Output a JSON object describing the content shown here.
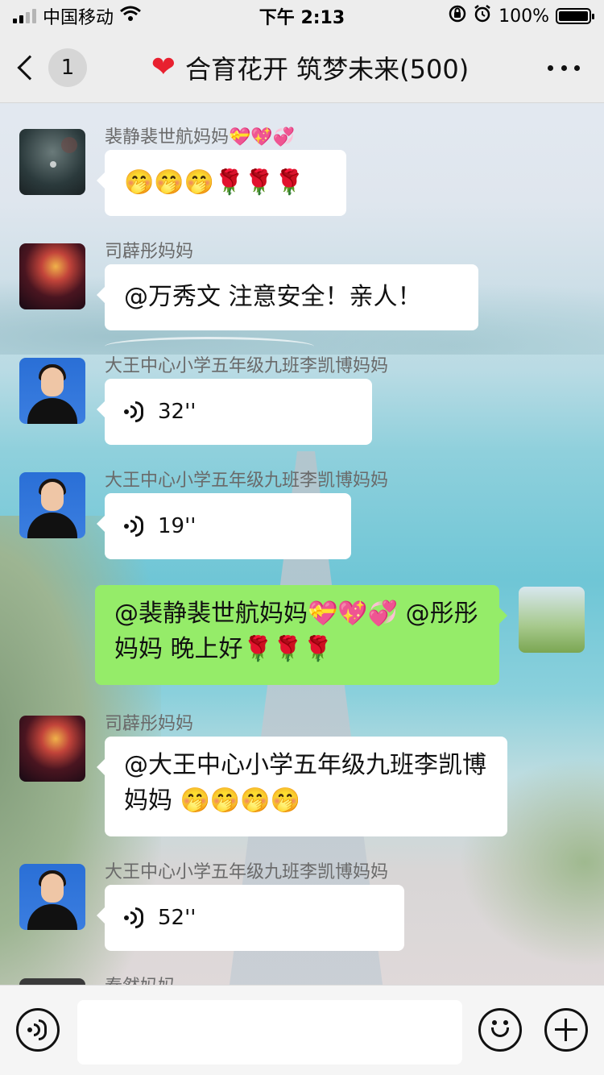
{
  "status_bar": {
    "carrier": "中国移动",
    "time": "下午 2:13",
    "battery_percent": "100%"
  },
  "nav": {
    "back_unread_count": "1",
    "title": "合育花开 筑梦未来(500)",
    "title_icon": "red-heart"
  },
  "messages": [
    {
      "sender": "裴静裴世航妈妈",
      "sender_emoji": "💝💖💞",
      "type": "text",
      "content": "🤭🤭🤭🌹🌹🌹",
      "avatar": "night-sky"
    },
    {
      "sender": "司薜彤妈妈",
      "type": "text",
      "content": "@万秀文 注意安全！亲人！",
      "avatar": "fireworks"
    },
    {
      "sender": "大王中心小学五年级九班李凯博妈妈",
      "type": "voice",
      "content": "32''",
      "avatar": "portrait-woman"
    },
    {
      "sender": "大王中心小学五年级九班李凯博妈妈",
      "type": "voice",
      "content": "19''",
      "avatar": "portrait-woman"
    },
    {
      "sender": "",
      "type": "text",
      "self": true,
      "content": "@裴静裴世航妈妈💝💖💞 @彤彤妈妈 晚上好🌹🌹🌹",
      "avatar": "landscape"
    },
    {
      "sender": "司薜彤妈妈",
      "type": "text",
      "content": "@大王中心小学五年级九班李凯博妈妈 🤭🤭🤭🤭",
      "avatar": "fireworks"
    },
    {
      "sender": "大王中心小学五年级九班李凯博妈妈",
      "type": "voice",
      "content": "52''",
      "avatar": "portrait-woman"
    },
    {
      "sender": "秦然妈妈",
      "type": "partial",
      "content": "",
      "avatar": "dark"
    }
  ],
  "input_bar": {
    "placeholder": "",
    "voice_icon": "voice-wave-icon",
    "emoji_icon": "smiley-icon",
    "plus_icon": "plus-icon"
  },
  "colors": {
    "nav_bg": "#ededed",
    "bubble_other": "#ffffff",
    "bubble_self": "#95ec69",
    "sender_text": "#6a6a6a"
  }
}
